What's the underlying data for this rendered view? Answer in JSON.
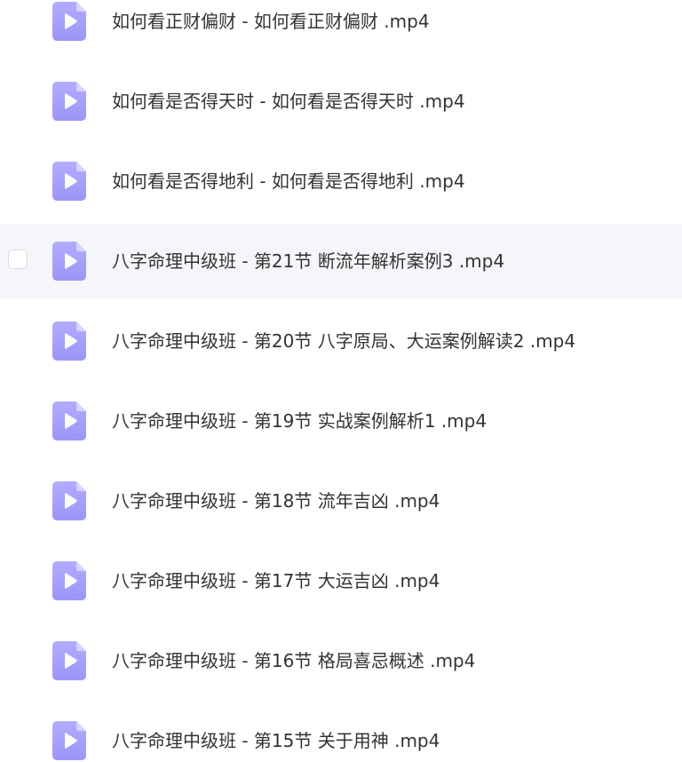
{
  "colors": {
    "icon_top": "#b2acff",
    "icon_bottom": "#9b96f7",
    "icon_fold": "#d6d3ff",
    "text": "#333333",
    "hover_bg": "#f5f6f9"
  },
  "files": [
    {
      "name": "如何看正财偏财 - 如何看正财偏财 .mp4",
      "icon": "video-file-icon",
      "hovered": false
    },
    {
      "name": "如何看是否得天时 - 如何看是否得天时 .mp4",
      "icon": "video-file-icon",
      "hovered": false
    },
    {
      "name": "如何看是否得地利 - 如何看是否得地利 .mp4",
      "icon": "video-file-icon",
      "hovered": false
    },
    {
      "name": "八字命理中级班 - 第21节 断流年解析案例3 .mp4",
      "icon": "video-file-icon",
      "hovered": true
    },
    {
      "name": "八字命理中级班 - 第20节 八字原局、大运案例解读2 .mp4",
      "icon": "video-file-icon",
      "hovered": false
    },
    {
      "name": "八字命理中级班 - 第19节 实战案例解析1 .mp4",
      "icon": "video-file-icon",
      "hovered": false
    },
    {
      "name": "八字命理中级班 - 第18节 流年吉凶 .mp4",
      "icon": "video-file-icon",
      "hovered": false
    },
    {
      "name": "八字命理中级班 - 第17节 大运吉凶 .mp4",
      "icon": "video-file-icon",
      "hovered": false
    },
    {
      "name": "八字命理中级班 - 第16节 格局喜忌概述 .mp4",
      "icon": "video-file-icon",
      "hovered": false
    },
    {
      "name": "八字命理中级班 - 第15节 关于用神 .mp4",
      "icon": "video-file-icon",
      "hovered": false
    }
  ]
}
